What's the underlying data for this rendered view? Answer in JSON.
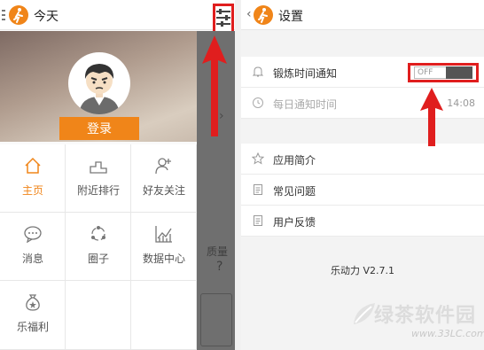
{
  "left": {
    "header_title": "今天",
    "login_label": "登录",
    "menu": [
      {
        "label": "主页",
        "icon": "home-icon"
      },
      {
        "label": "附近排行",
        "icon": "podium-icon"
      },
      {
        "label": "好友关注",
        "icon": "add-friend-icon"
      },
      {
        "label": "消息",
        "icon": "message-icon"
      },
      {
        "label": "圈子",
        "icon": "circle-icon"
      },
      {
        "label": "数据中心",
        "icon": "data-chart-icon"
      },
      {
        "label": "乐福利",
        "icon": "gift-bag-icon"
      }
    ],
    "overlay_text": "质量",
    "overlay_question": "?"
  },
  "right": {
    "header_title": "设置",
    "settings": [
      {
        "label": "锻炼时间通知",
        "icon": "bell-icon",
        "toggle": "OFF"
      },
      {
        "label": "每日通知时间",
        "icon": "clock-icon",
        "value": "14:08"
      }
    ],
    "items": [
      {
        "label": "应用简介",
        "icon": "star-icon"
      },
      {
        "label": "常见问题",
        "icon": "document-icon"
      },
      {
        "label": "用户反馈",
        "icon": "feedback-icon"
      }
    ],
    "version": "乐动力 V2.7.1"
  },
  "watermark": {
    "text": "绿茶软件园",
    "url": "www.33LC.com"
  },
  "colors": {
    "accent": "#f08519",
    "highlight": "#e01e1e",
    "overlay": "#6f6f6f"
  }
}
